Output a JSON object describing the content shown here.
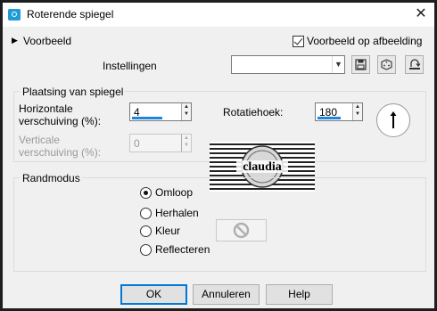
{
  "window": {
    "title": "Roterende spiegel",
    "close_glyph": "✕"
  },
  "header": {
    "preview_toggle_label": "Voorbeeld",
    "preview_on_image_label": "Voorbeeld op afbeelding",
    "preview_on_image_checked": true,
    "settings_label": "Instellingen",
    "settings_value": ""
  },
  "mirror_group": {
    "title": "Plaatsing van spiegel",
    "horizontal_label_1": "Horizontale",
    "horizontal_label_2": "verschuiving (%):",
    "horizontal_value": "4",
    "vertical_label_1": "Verticale",
    "vertical_label_2": "verschuiving (%):",
    "vertical_value": "0",
    "rotation_label": "Rotatiehoek:",
    "rotation_value": "180"
  },
  "preview_thumb": {
    "text": "claudia"
  },
  "edge_group": {
    "title": "Randmodus",
    "options": [
      "Omloop",
      "Herhalen",
      "Kleur",
      "Reflecteren"
    ],
    "selected": "Omloop"
  },
  "footer": {
    "ok_label": "OK",
    "cancel_label": "Annuleren",
    "help_label": "Help"
  },
  "colors": {
    "accent": "#0078d7",
    "value_bar": "#1f86e0"
  }
}
